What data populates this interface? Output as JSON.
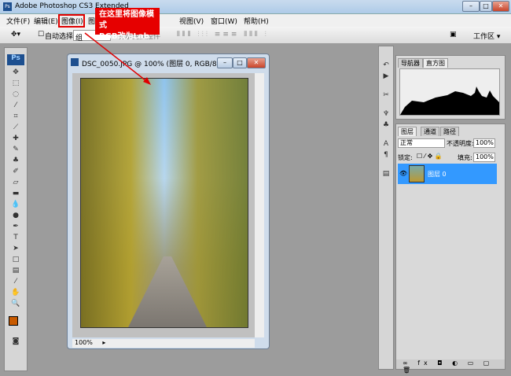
{
  "window": {
    "title": "Adobe Photoshop CS3 Extended",
    "min": "–",
    "max": "□",
    "close": "✕"
  },
  "menu": [
    "文件(F)",
    "编辑(E)",
    "图像(I)",
    "图",
    "视图(V)",
    "窗口(W)",
    "帮助(H)"
  ],
  "options": {
    "auto_select": "自动选择:",
    "group": "组",
    "show_transform": "显示变换控件",
    "workspace": "工作区 ▾"
  },
  "callout": {
    "line1": "在这里将图像模式",
    "line2": "RGB改为Lab"
  },
  "document": {
    "title": "DSC_0050.JPG @ 100% (图层 0, RGB/8)",
    "zoom": "100%"
  },
  "panels": {
    "navigator_tab": "导航器",
    "histogram_tab": "直方图",
    "layers_tab": "图层",
    "channels_tab": "通道",
    "paths_tab": "路径",
    "blend_mode": "正常",
    "opacity_label": "不透明度:",
    "opacity": "100%",
    "lock_label": "锁定:",
    "fill_label": "填充:",
    "fill": "100%",
    "layer_name": "图层 0"
  },
  "toolbox": {
    "logo": "Ps"
  },
  "colors": {
    "accent": "#e60000",
    "selection": "#3399ff",
    "foreground": "#c85a00"
  }
}
